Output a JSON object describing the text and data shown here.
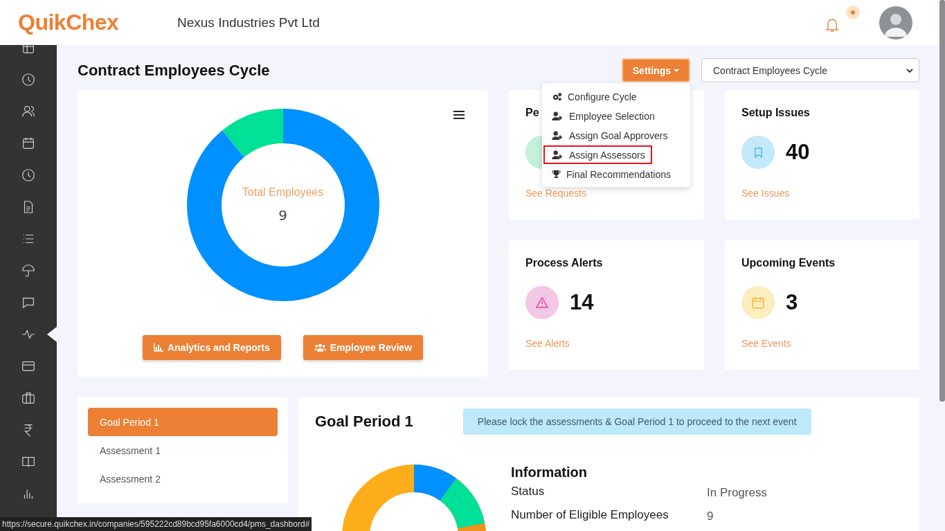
{
  "header": {
    "logo": "QuikChex",
    "company": "Nexus Industries Pvt Ltd",
    "notifications": {
      "unread": true
    }
  },
  "sidebar": {
    "items": [
      {
        "selected": false
      },
      {
        "selected": false
      },
      {
        "selected": false
      },
      {
        "selected": false
      },
      {
        "selected": false
      },
      {
        "selected": false
      },
      {
        "selected": false
      },
      {
        "selected": false
      },
      {
        "selected": false
      },
      {
        "selected": true
      },
      {
        "selected": false
      },
      {
        "selected": false
      },
      {
        "selected": false
      },
      {
        "selected": false
      },
      {
        "selected": false
      }
    ]
  },
  "page": {
    "title": "Contract Employees Cycle",
    "settings_button": "Settings",
    "cycle_select": "Contract Employees Cycle"
  },
  "settings_menu": {
    "items": [
      {
        "label": "Configure Cycle",
        "kind": "gears",
        "highlighted": false
      },
      {
        "label": "Employee Selection",
        "kind": "user-add",
        "highlighted": false
      },
      {
        "label": "Assign Goal Approvers",
        "kind": "user-add",
        "highlighted": false
      },
      {
        "label": "Assign Assessors",
        "kind": "user-add",
        "highlighted": true
      },
      {
        "label": "Final Recommendations",
        "kind": "trophy",
        "highlighted": false
      }
    ]
  },
  "summary": {
    "center_label": "Total Employees",
    "center_value": "9",
    "buttons": [
      {
        "label": "Analytics and Reports",
        "kind": "chart"
      },
      {
        "label": "Employee Review",
        "kind": "users"
      }
    ]
  },
  "stat_cards": [
    {
      "title": "Pe",
      "link": "See Requests",
      "kind": "requests",
      "color": "#c5f0da"
    },
    {
      "title": "Setup Issues",
      "value": "40",
      "link": "See Issues",
      "kind": "bookmark",
      "color": "#c4e9fb"
    },
    {
      "title": "Process Alerts",
      "value": "14",
      "link": "See Alerts",
      "kind": "alert",
      "color": "#f3c7e6"
    },
    {
      "title": "Upcoming Events",
      "value": "3",
      "link": "See Events",
      "kind": "calendar",
      "color": "#fdeec0"
    }
  ],
  "periods": [
    {
      "label": "Goal Period 1",
      "selected": true
    },
    {
      "label": "Assessment 1",
      "selected": false
    },
    {
      "label": "Assessment 2",
      "selected": false
    }
  ],
  "detail": {
    "title": "Goal Period 1",
    "notice": "Please lock the assessments & Goal Period 1 to proceed to the next event",
    "info_title": "Information",
    "info": [
      {
        "label": "Status",
        "value": "In Progress"
      },
      {
        "label": "Number of Eligible Employees",
        "value": "9"
      }
    ]
  },
  "status_url": "https://secure.quikchex.in/companies/595222cd89bcd95fa6000cd4/pms_dashbord#"
}
